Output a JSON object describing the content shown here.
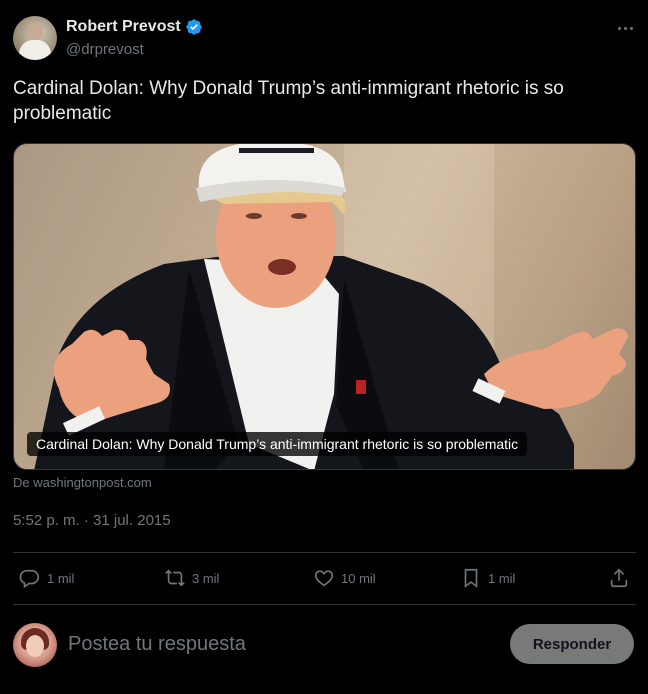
{
  "author": {
    "display_name": "Robert Prevost",
    "handle": "@drprevost",
    "verified": true
  },
  "tweet": {
    "text": "Cardinal Dolan: Why Donald Trump’s anti-immigrant rhetoric is so problematic",
    "timestamp": "5:52 p. m. · 31 jul. 2015"
  },
  "card": {
    "caption": "Cardinal Dolan: Why Donald Trump’s anti-immigrant rhetoric is so problematic",
    "source": "De washingtonpost.com",
    "image_icon": "photo-man-white-cap-dark-jacket"
  },
  "actions": {
    "reply_count": "1 mil",
    "repost_count": "3 mil",
    "like_count": "10 mil",
    "bookmark_count": "1 mil"
  },
  "reply_box": {
    "placeholder": "Postea tu respuesta",
    "button_label": "Responder"
  },
  "colors": {
    "background": "#000000",
    "text_primary": "#e7e9ea",
    "text_secondary": "#71767b",
    "verified_blue": "#1d9bf0",
    "divider": "#2f3336",
    "reply_button": "#787a7a"
  }
}
